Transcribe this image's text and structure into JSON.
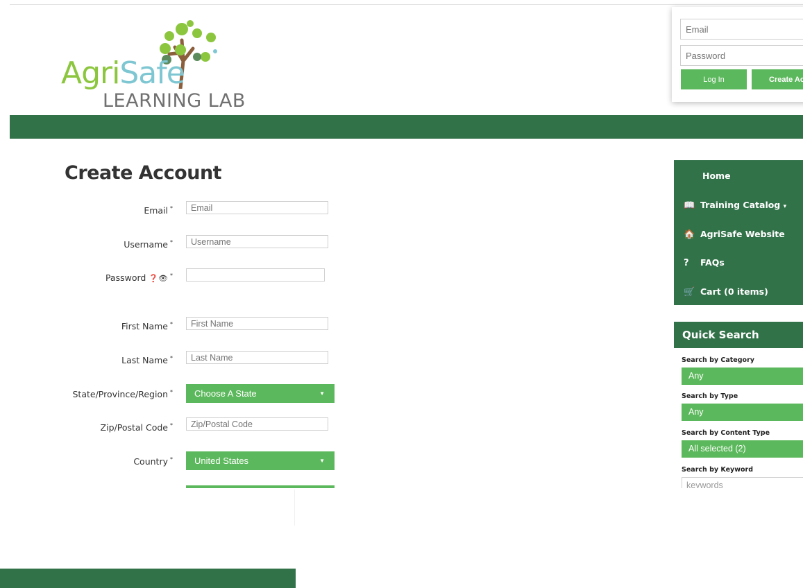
{
  "logo": {
    "text_agri": "Agri",
    "text_safe": "Safe",
    "text_lab": "LEARNING LAB",
    "colors": {
      "agri": "#8cc63e",
      "safe": "#7ec7d2",
      "lab": "#707070"
    }
  },
  "login": {
    "email_placeholder": "Email",
    "password_placeholder": "Password",
    "login_label": "Log In",
    "create_label": "Create Account"
  },
  "form": {
    "title": "Create Account",
    "required_mark": "*",
    "email": {
      "label": "Email",
      "placeholder": "Email"
    },
    "username": {
      "label": "Username",
      "placeholder": "Username"
    },
    "password": {
      "label": "Password",
      "icons": "❓👁"
    },
    "first_name": {
      "label": "First Name",
      "placeholder": "First Name"
    },
    "last_name": {
      "label": "Last Name",
      "placeholder": "Last Name"
    },
    "state": {
      "label": "State/Province/Region",
      "value": "Choose A State"
    },
    "zip": {
      "label": "Zip/Postal Code",
      "placeholder": "Zip/Postal Code"
    },
    "country": {
      "label": "Country",
      "value": "United States"
    }
  },
  "sidebar": {
    "items": [
      {
        "label": "Home",
        "icon": ""
      },
      {
        "label": "Training Catalog",
        "icon": "book-icon",
        "caret": "▾"
      },
      {
        "label": "AgriSafe Website",
        "icon": "home-icon"
      },
      {
        "label": "FAQs",
        "icon": "question-icon"
      },
      {
        "label": "Cart (0 items)",
        "icon": "cart-icon"
      }
    ]
  },
  "quick_search": {
    "title": "Quick Search",
    "category_label": "Search by Category",
    "category_value": "Any",
    "type_label": "Search by Type",
    "type_value": "Any",
    "content_type_label": "Search by Content Type",
    "content_type_value": "All selected (2)",
    "keyword_label": "Search by Keyword",
    "keyword_placeholder": "keywords"
  },
  "colors": {
    "dark_green": "#327249",
    "button_green": "#5cb85c"
  }
}
